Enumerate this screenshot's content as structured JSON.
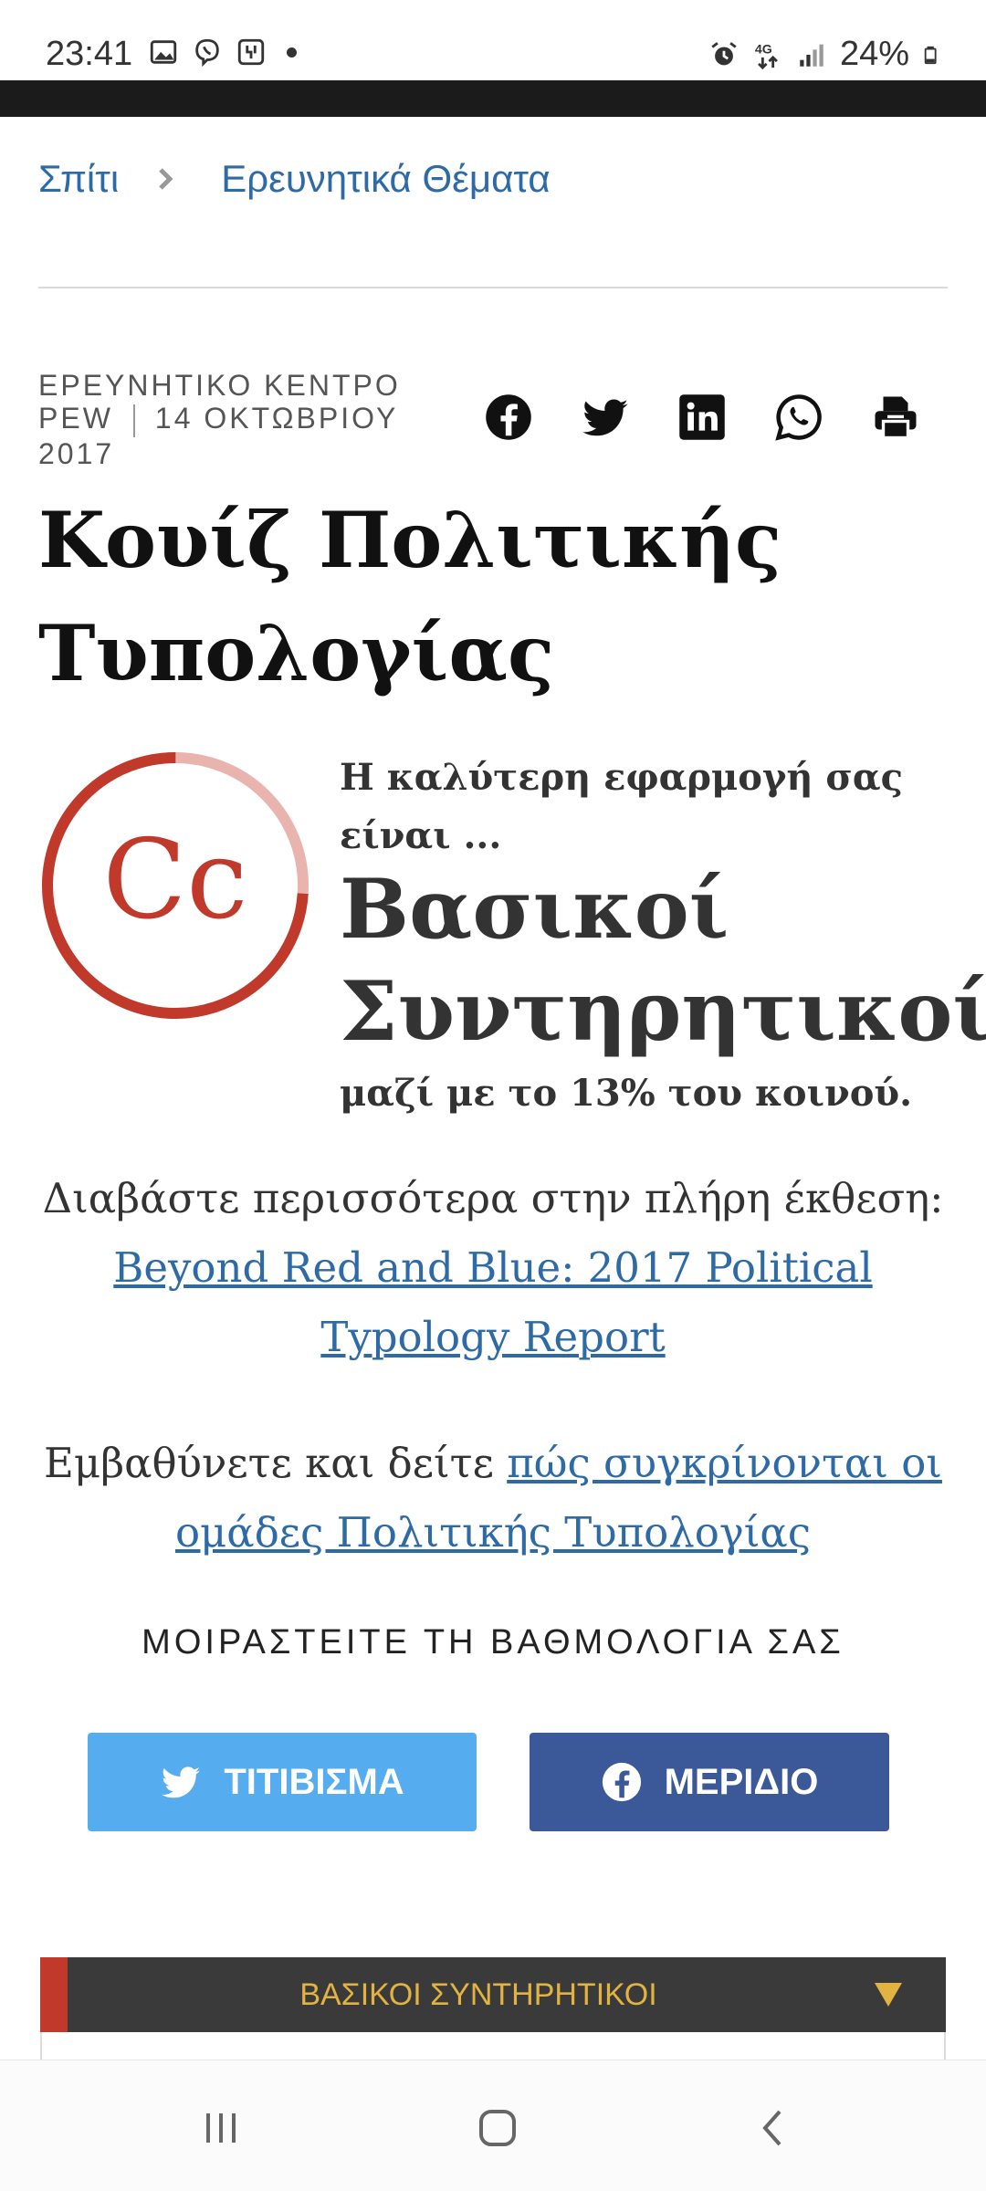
{
  "status_bar": {
    "time": "23:41",
    "battery": "24%",
    "left_icons": [
      "gallery-icon",
      "viber-icon",
      "voicemail-icon",
      "dot-icon"
    ],
    "right_icons": [
      "alarm-icon",
      "network-4g-icon",
      "signal-icon",
      "battery-icon"
    ]
  },
  "breadcrumb": {
    "home": "Σπίτι",
    "current": "Ερευνητικά Θέματα"
  },
  "meta": {
    "source": "ΕΡΕΥΝΗΤΙΚΟ ΚΕΝΤΡΟ PEW",
    "date": "14 ΟΚΤΩΒΡΙΟΥ 2017"
  },
  "share_icons": [
    "facebook-icon",
    "twitter-icon",
    "linkedin-icon",
    "whatsapp-icon",
    "print-icon"
  ],
  "title": "Κουίζ Πολιτικής Τυπολογίας",
  "result": {
    "badge": "Cc",
    "badge_color": "#c0392b",
    "badge_track_color": "#e8b4ad",
    "share_fraction": 0.13,
    "pre": "Η καλύτερη εφαρμογή σας είναι ...",
    "group": "Βασικοί Συντηρητικοί",
    "post": "μαζί με το 13% του κοινού."
  },
  "readmore": {
    "text": "Διαβάστε περισσότερα στην πλήρη έκθεση:",
    "link": "Beyond Red and Blue: 2017 Political Typology Report"
  },
  "deeper": {
    "text": "Εμβαθύνετε και δείτε ",
    "link": "πώς συγκρίνονται οι ομάδες Πολιτικής Τυπολογίας"
  },
  "share_heading": "ΜΟΙΡΑΣΤΕΙΤΕ ΤΗ ΒΑΘΜΟΛΟΓΙΑ ΣΑΣ",
  "buttons": {
    "tweet": "ΤΙΤΙΒΙΣΜΑ",
    "share": "ΜΕΡΙΔΙΟ",
    "tweet_color": "#55acee",
    "share_color": "#3b5998"
  },
  "accordion": {
    "label": "ΒΑΣΙΚΟΙ ΣΥΝΤΗΡΗΤΙΚΟΙ",
    "accent_color": "#c0392b",
    "label_color": "#e3b341"
  },
  "nav": [
    "recent-apps-icon",
    "home-icon",
    "back-icon"
  ]
}
